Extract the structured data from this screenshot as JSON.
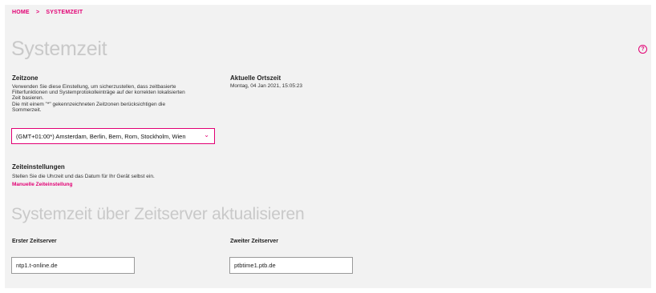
{
  "breadcrumb": {
    "home": "HOME",
    "separator": ">",
    "current": "SYSTEMZEIT"
  },
  "page": {
    "title": "Systemzeit",
    "help_icon": "question-circle-icon"
  },
  "zeitzone": {
    "heading": "Zeitzone",
    "description_1": "Verwenden Sie diese Einstellung, um sicherzustellen, dass zeitbasierte",
    "description_2": "Filterfunktionen und Systemprotokolleinträge auf der korrekten lokalisierten",
    "description_3": "Zeit basieren.",
    "description_4": "Die mit einem \"*\" gekennzeichneten Zeitzonen berücksichtigen die",
    "description_5": "Sommerzeit.",
    "selected": "(GMT+01:00*) Amsterdam, Berlin, Bern, Rom, Stockholm, Wien",
    "chevron_icon": "chevron-down-icon"
  },
  "ortszeit": {
    "heading": "Aktuelle Ortszeit",
    "value": "Montag, 04 Jan 2021, 15:05:23"
  },
  "zeiteinstellungen": {
    "heading": "Zeiteinstellungen",
    "description": "Stellen Sie die Uhrzeit und das Datum für Ihr Gerät selbst ein.",
    "link": "Manuelle Zeiteinstellung"
  },
  "zeitserver": {
    "title": "Systemzeit über Zeitserver aktualisieren",
    "first_label": "Erster Zeitserver",
    "first_value": "ntp1.t-online.de",
    "second_label": "Zweiter Zeitserver",
    "second_value": "ptbtime1.ptb.de"
  },
  "colors": {
    "accent": "#e20074",
    "panel": "#f2f2f2",
    "title_gray": "#c9c9c9"
  }
}
